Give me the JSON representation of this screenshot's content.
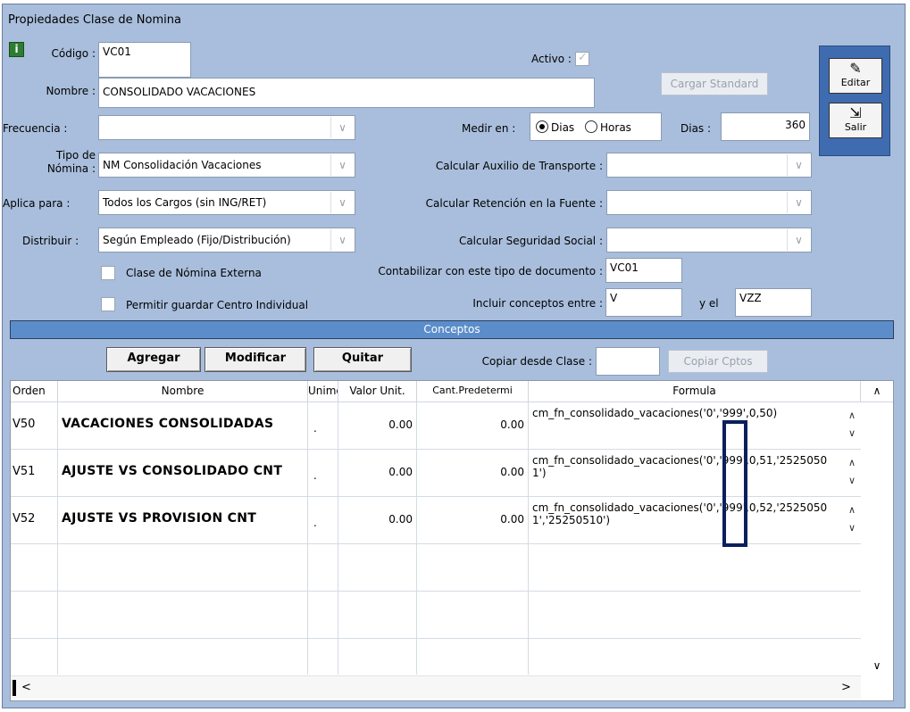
{
  "window": {
    "title": "Propiedades Clase de Nomina"
  },
  "form": {
    "codigo_label": "Código :",
    "codigo_value": "VC01",
    "activo_label": "Activo :",
    "nombre_label": "Nombre :",
    "nombre_value": "CONSOLIDADO VACACIONES",
    "cargar_standard": "Cargar Standard",
    "frecuencia_label": "Frecuencia :",
    "frecuencia_value": "",
    "medir_label": "Medir en :",
    "medir_dias": "Dias",
    "medir_horas": "Horas",
    "medir_selected": "Dias",
    "dias_label": "Dias :",
    "dias_value": "360",
    "tipo_label_1": "Tipo de",
    "tipo_label_2": "Nómina :",
    "tipo_value": "NM Consolidación Vacaciones",
    "auxilio_label": "Calcular Auxilio de Transporte :",
    "aplica_label": "Aplica para :",
    "aplica_value": "Todos los Cargos (sin ING/RET)",
    "retencion_label": "Calcular Retención en la Fuente :",
    "distribuir_label": "Distribuir :",
    "distribuir_value": "Según Empleado (Fijo/Distribución)",
    "seguridad_label": "Calcular Seguridad Social :",
    "externa_label": "Clase de Nómina Externa",
    "contabilizar_label": "Contabilizar con este tipo de documento :",
    "contabilizar_value": "VC01",
    "centro_label": "Permitir guardar Centro Individual",
    "incluir_label": "Incluir conceptos entre :",
    "incluir_from": "V",
    "incluir_yel": "y el",
    "incluir_to": "VZZ"
  },
  "side": {
    "editar": "Editar",
    "salir": "Salir"
  },
  "conceptos": {
    "header": "Conceptos",
    "agregar": "Agregar",
    "modificar": "Modificar",
    "quitar": "Quitar",
    "copiar_label": "Copiar desde Clase :",
    "copiar_value": "",
    "copiar_btn": "Copiar Cptos"
  },
  "grid": {
    "columns": [
      "Orden",
      "Nombre",
      "Unimed",
      "Valor Unit.",
      "Cant.Predetermi",
      "Formula"
    ],
    "rows": [
      {
        "orden": "V50",
        "nombre": "VACACIONES CONSOLIDADAS",
        "unimed": ".",
        "valor": "0.00",
        "cant": "0.00",
        "formula": "cm_fn_consolidado_vacaciones('0','999',0,50)"
      },
      {
        "orden": "V51",
        "nombre": "AJUSTE VS CONSOLIDADO CNT",
        "unimed": ".",
        "valor": "0.00",
        "cant": "0.00",
        "formula": "cm_fn_consolidado_vacaciones('0','999',0,51,'25250501')"
      },
      {
        "orden": "V52",
        "nombre": "AJUSTE VS PROVISION CNT",
        "unimed": ".",
        "valor": "0.00",
        "cant": "0.00",
        "formula": "cm_fn_consolidado_vacaciones('0','999',0,52,'25250501','25250510')"
      }
    ]
  },
  "colors": {
    "window_bg": "#a9bedc",
    "header_bar": "#5b8dcb",
    "side_panel": "#3f6cb0",
    "highlight_box": "#0a1f5c"
  }
}
